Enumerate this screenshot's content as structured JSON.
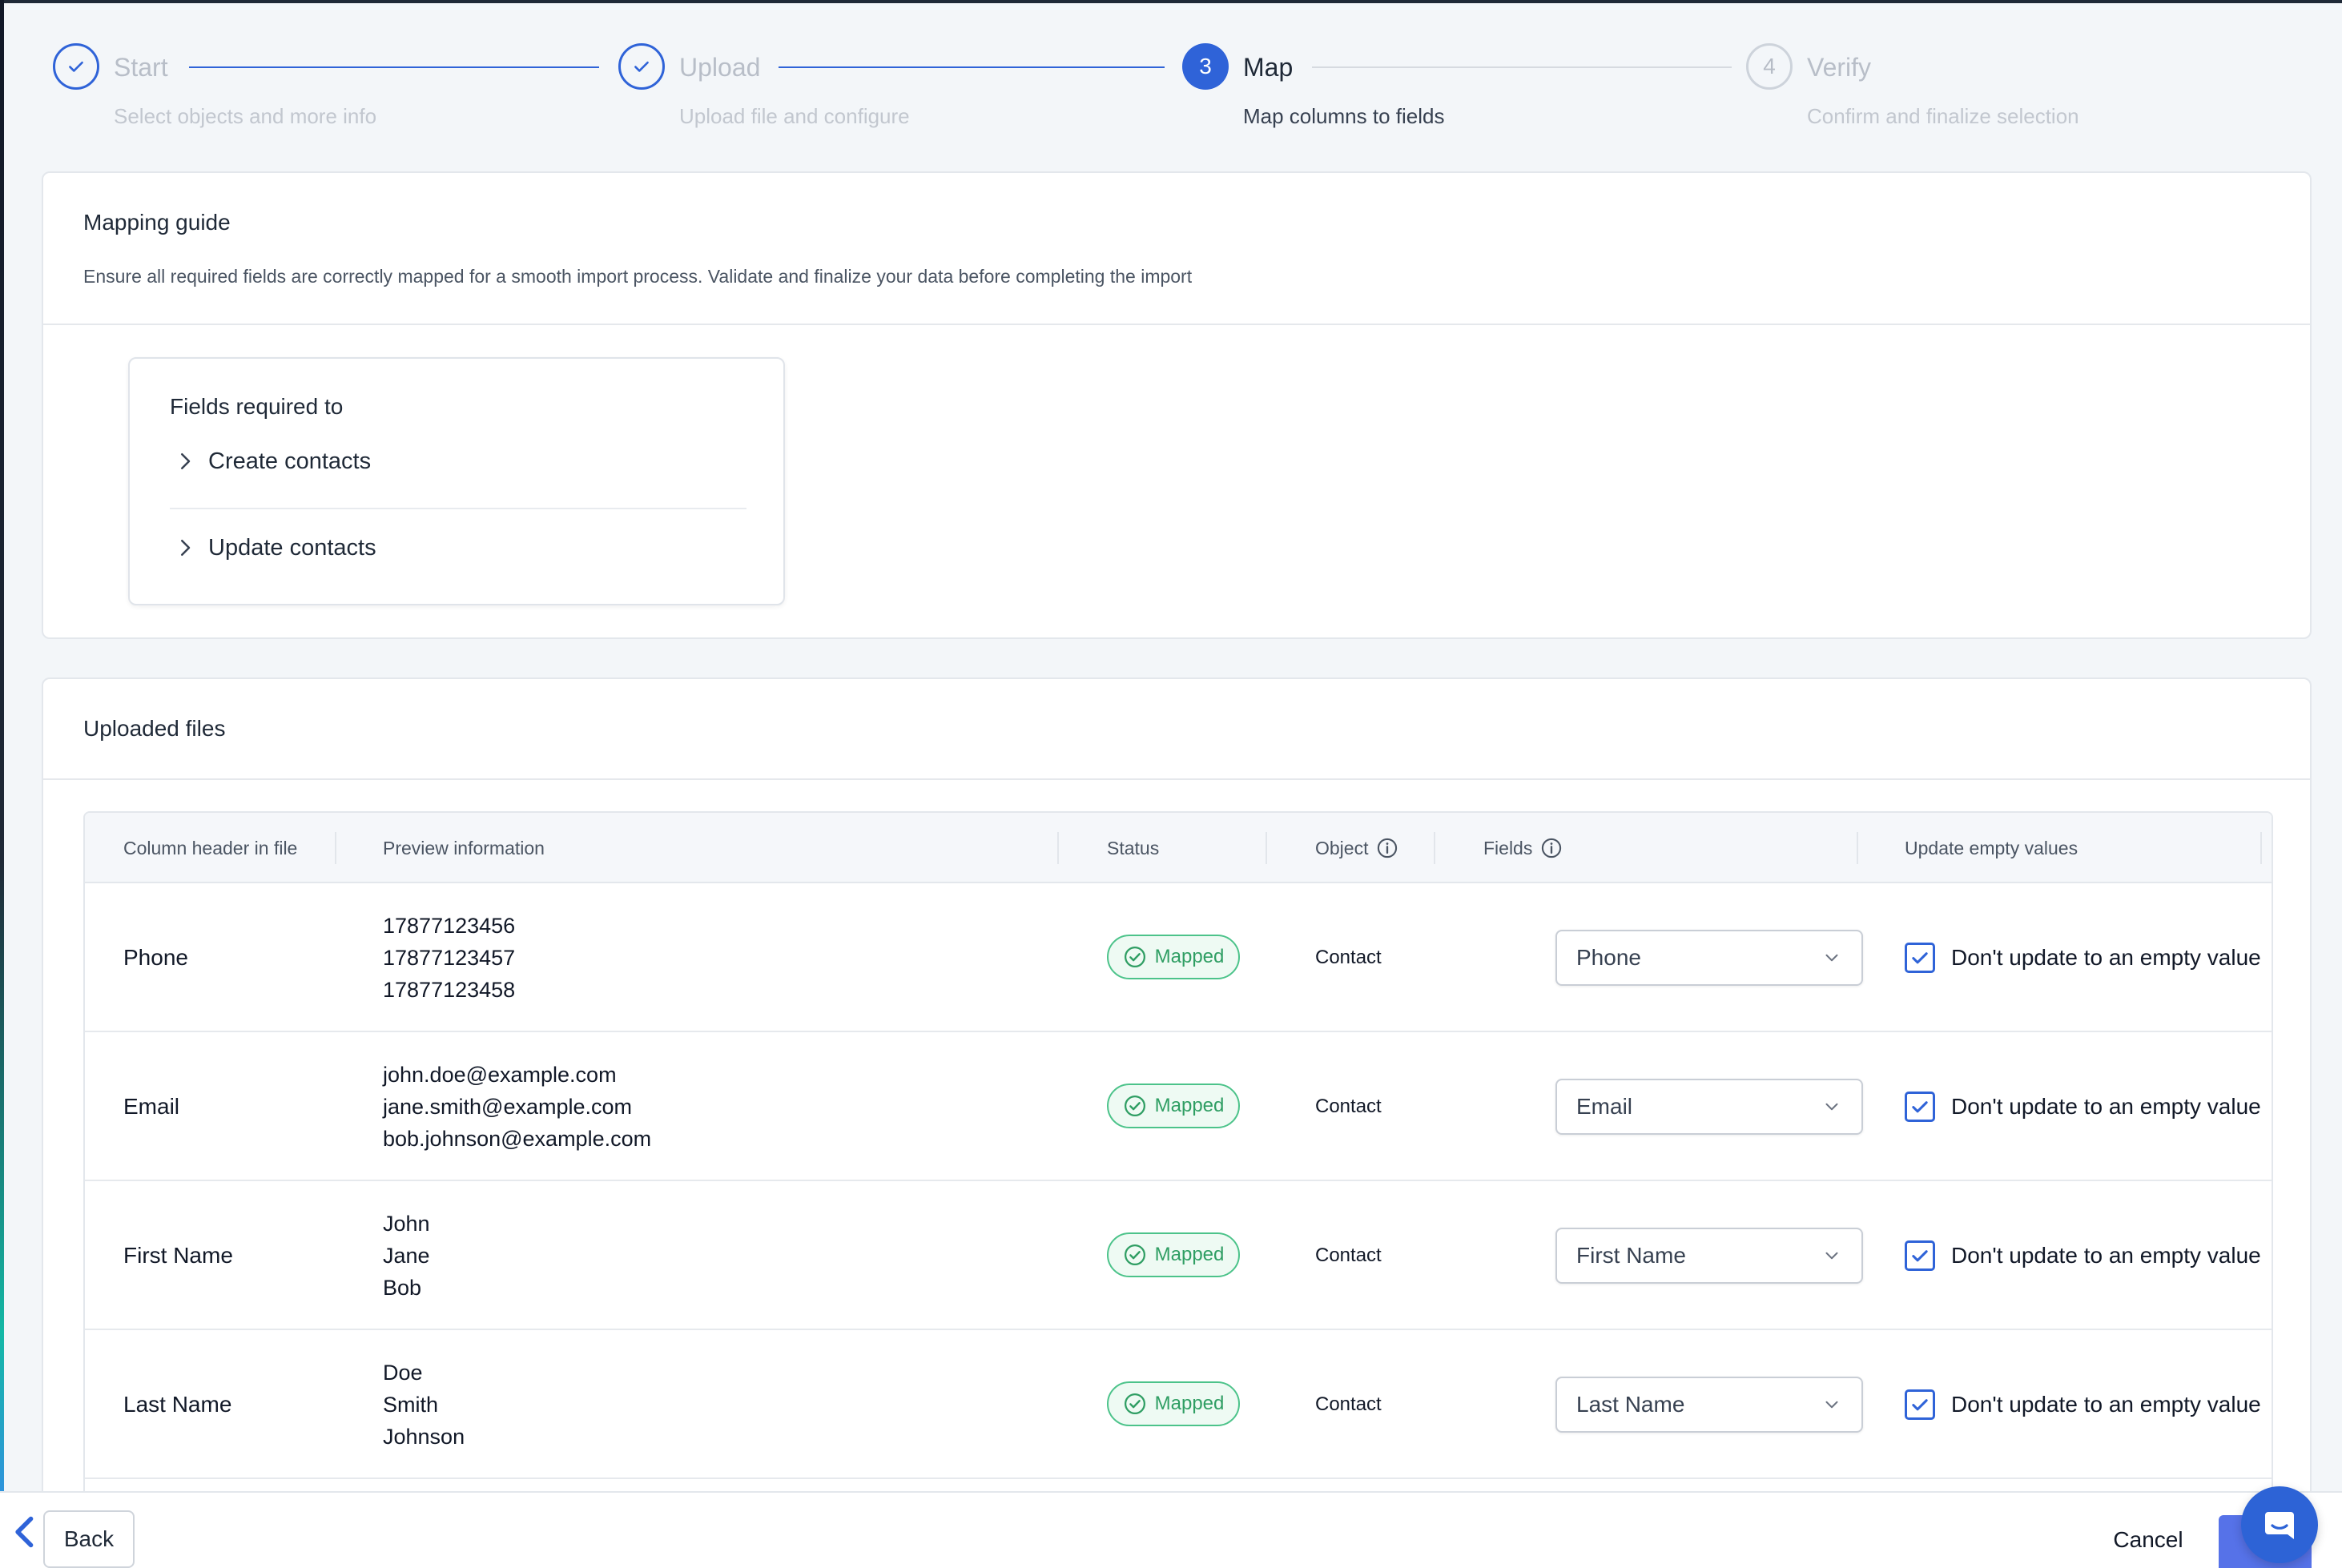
{
  "stepper": {
    "steps": [
      {
        "number": "1",
        "title": "Start",
        "subtitle": "Select objects and more info",
        "state": "done"
      },
      {
        "number": "2",
        "title": "Upload",
        "subtitle": "Upload file and configure",
        "state": "done"
      },
      {
        "number": "3",
        "title": "Map",
        "subtitle": "Map columns to fields",
        "state": "active"
      },
      {
        "number": "4",
        "title": "Verify",
        "subtitle": "Confirm and finalize selection",
        "state": "future"
      }
    ]
  },
  "mapping_guide": {
    "title": "Mapping guide",
    "description": "Ensure all required fields are correctly mapped for a smooth import process. Validate and finalize your data before completing the import",
    "required_box": {
      "title": "Fields required to",
      "items": [
        "Create contacts",
        "Update contacts"
      ]
    }
  },
  "uploaded_files": {
    "title": "Uploaded files",
    "columns": {
      "header": "Column header in file",
      "preview": "Preview information",
      "status": "Status",
      "object": "Object",
      "fields": "Fields",
      "update": "Update empty values"
    },
    "rows": [
      {
        "header": "Phone",
        "preview": [
          "17877123456",
          "17877123457",
          "17877123458"
        ],
        "status": "Mapped",
        "object": "Contact",
        "field": "Phone",
        "update_label": "Don't update to an empty value",
        "checked": true
      },
      {
        "header": "Email",
        "preview": [
          "john.doe@example.com",
          "jane.smith@example.com",
          "bob.johnson@example.com"
        ],
        "status": "Mapped",
        "object": "Contact",
        "field": "Email",
        "update_label": "Don't update to an empty value",
        "checked": true
      },
      {
        "header": "First Name",
        "preview": [
          "John",
          "Jane",
          "Bob"
        ],
        "status": "Mapped",
        "object": "Contact",
        "field": "First Name",
        "update_label": "Don't update to an empty value",
        "checked": true
      },
      {
        "header": "Last Name",
        "preview": [
          "Doe",
          "Smith",
          "Johnson"
        ],
        "status": "Mapped",
        "object": "Contact",
        "field": "Last Name",
        "update_label": "Don't update to an empty value",
        "checked": true
      }
    ]
  },
  "footer": {
    "back_label": "Back",
    "cancel_label": "Cancel"
  },
  "colors": {
    "primary": "#2f63d8",
    "success": "#2f9e63",
    "background": "#f3f6f9"
  }
}
